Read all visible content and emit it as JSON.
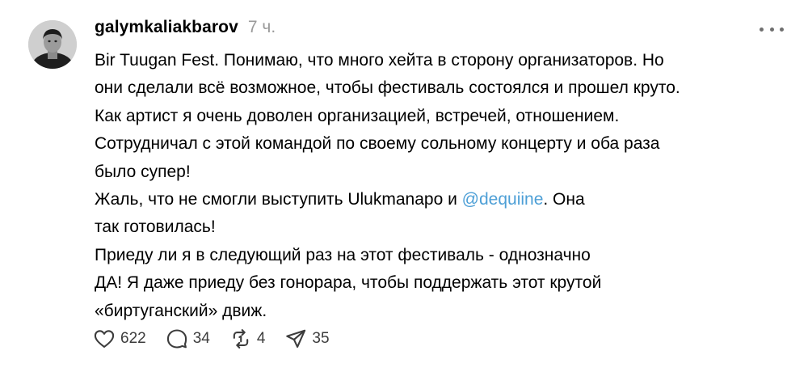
{
  "post": {
    "username": "galymkaliakbarov",
    "timestamp": "7 ч.",
    "lines": [
      "Bir Tuugan Fest. Понимаю, что много хейта в сторону организаторов. Но",
      "они сделали всё возможное, чтобы фестиваль состоялся и прошел круто.",
      "Как артист я очень доволен организацией, встречей, отношением.",
      "Сотрудничал с этой командой по своему сольному концерту и оба раза",
      "было супер!"
    ],
    "mention_line_before": "Жаль, что не смогли выступить Ulukmanapo и ",
    "mention": "@dequiine",
    "mention_line_after": ". Она",
    "lines_after": [
      "так готовилась!",
      "Приеду ли я в следующий раз на этот фестиваль - однозначно",
      "ДА! Я даже приеду без гонорара, чтобы поддержать этот крутой",
      "«биртуганский» движ."
    ]
  },
  "actions": {
    "likes": "622",
    "replies": "34",
    "reposts": "4",
    "shares": "35"
  },
  "icons": {
    "like": "heart-icon",
    "reply": "comment-icon",
    "repost": "repost-icon",
    "share": "send-icon",
    "more": "more-dots-icon"
  },
  "colors": {
    "mention": "#4d9fd6",
    "timestamp": "#9a9a9a",
    "icon": "#3c3c3c"
  }
}
